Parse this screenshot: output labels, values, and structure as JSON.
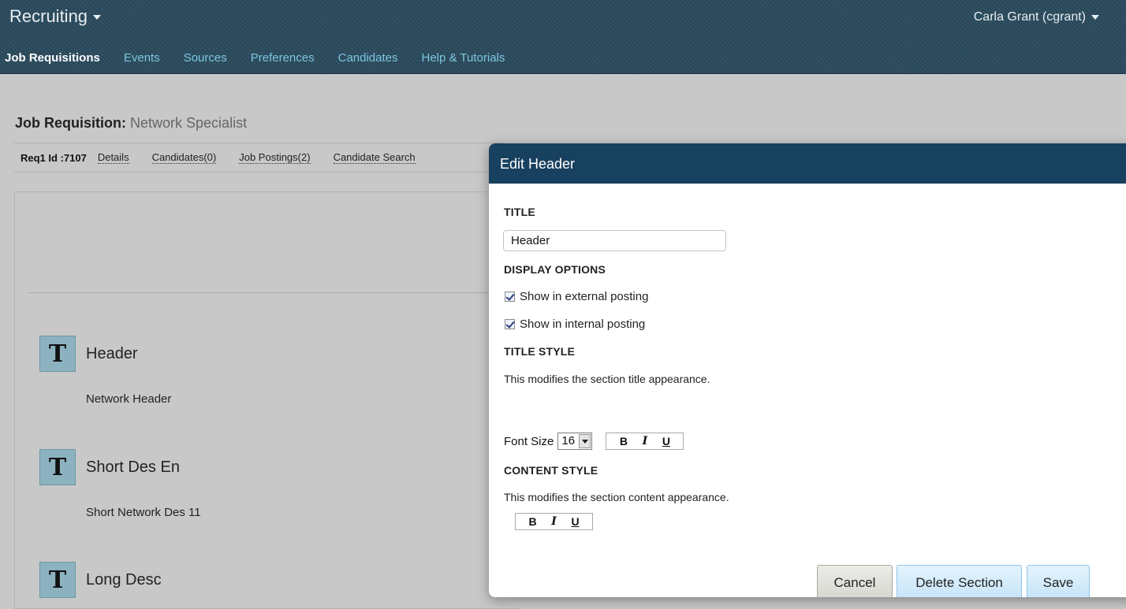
{
  "app": {
    "title": "Recruiting",
    "user": "Carla Grant (cgrant)"
  },
  "nav": {
    "items": [
      {
        "label": "Job Requisitions",
        "active": true
      },
      {
        "label": "Events"
      },
      {
        "label": "Sources"
      },
      {
        "label": "Preferences"
      },
      {
        "label": "Candidates"
      },
      {
        "label": "Help & Tutorials"
      }
    ]
  },
  "page": {
    "title_label": "Job Requisition:",
    "title_value": "Network Specialist"
  },
  "subnav": {
    "req_id": "Req1 Id :7107",
    "links": [
      "Details",
      "Candidates(0)",
      "Job Postings(2)",
      "Candidate Search"
    ]
  },
  "sections": [
    {
      "icon": "T",
      "title": "Header",
      "content": "Network Header"
    },
    {
      "icon": "T",
      "title": "Short Des En",
      "content": "Short Network Des 11"
    },
    {
      "icon": "T",
      "title": "Long Desc",
      "content": ""
    }
  ],
  "modal": {
    "title": "Edit Header",
    "title_label": "TITLE",
    "title_value": "Header",
    "display_options_label": "DISPLAY OPTIONS",
    "show_external": "Show in external posting",
    "show_internal": "Show in internal posting",
    "title_style_label": "TITLE STYLE",
    "title_style_help": "This modifies the section title appearance.",
    "font_size_label": "Font Size",
    "font_size_value": "16",
    "content_style_label": "CONTENT STYLE",
    "content_style_help": "This modifies the section content appearance.",
    "format": {
      "bold": "B",
      "italic": "I",
      "underline": "U"
    },
    "buttons": {
      "cancel": "Cancel",
      "delete": "Delete Section",
      "save": "Save"
    }
  }
}
